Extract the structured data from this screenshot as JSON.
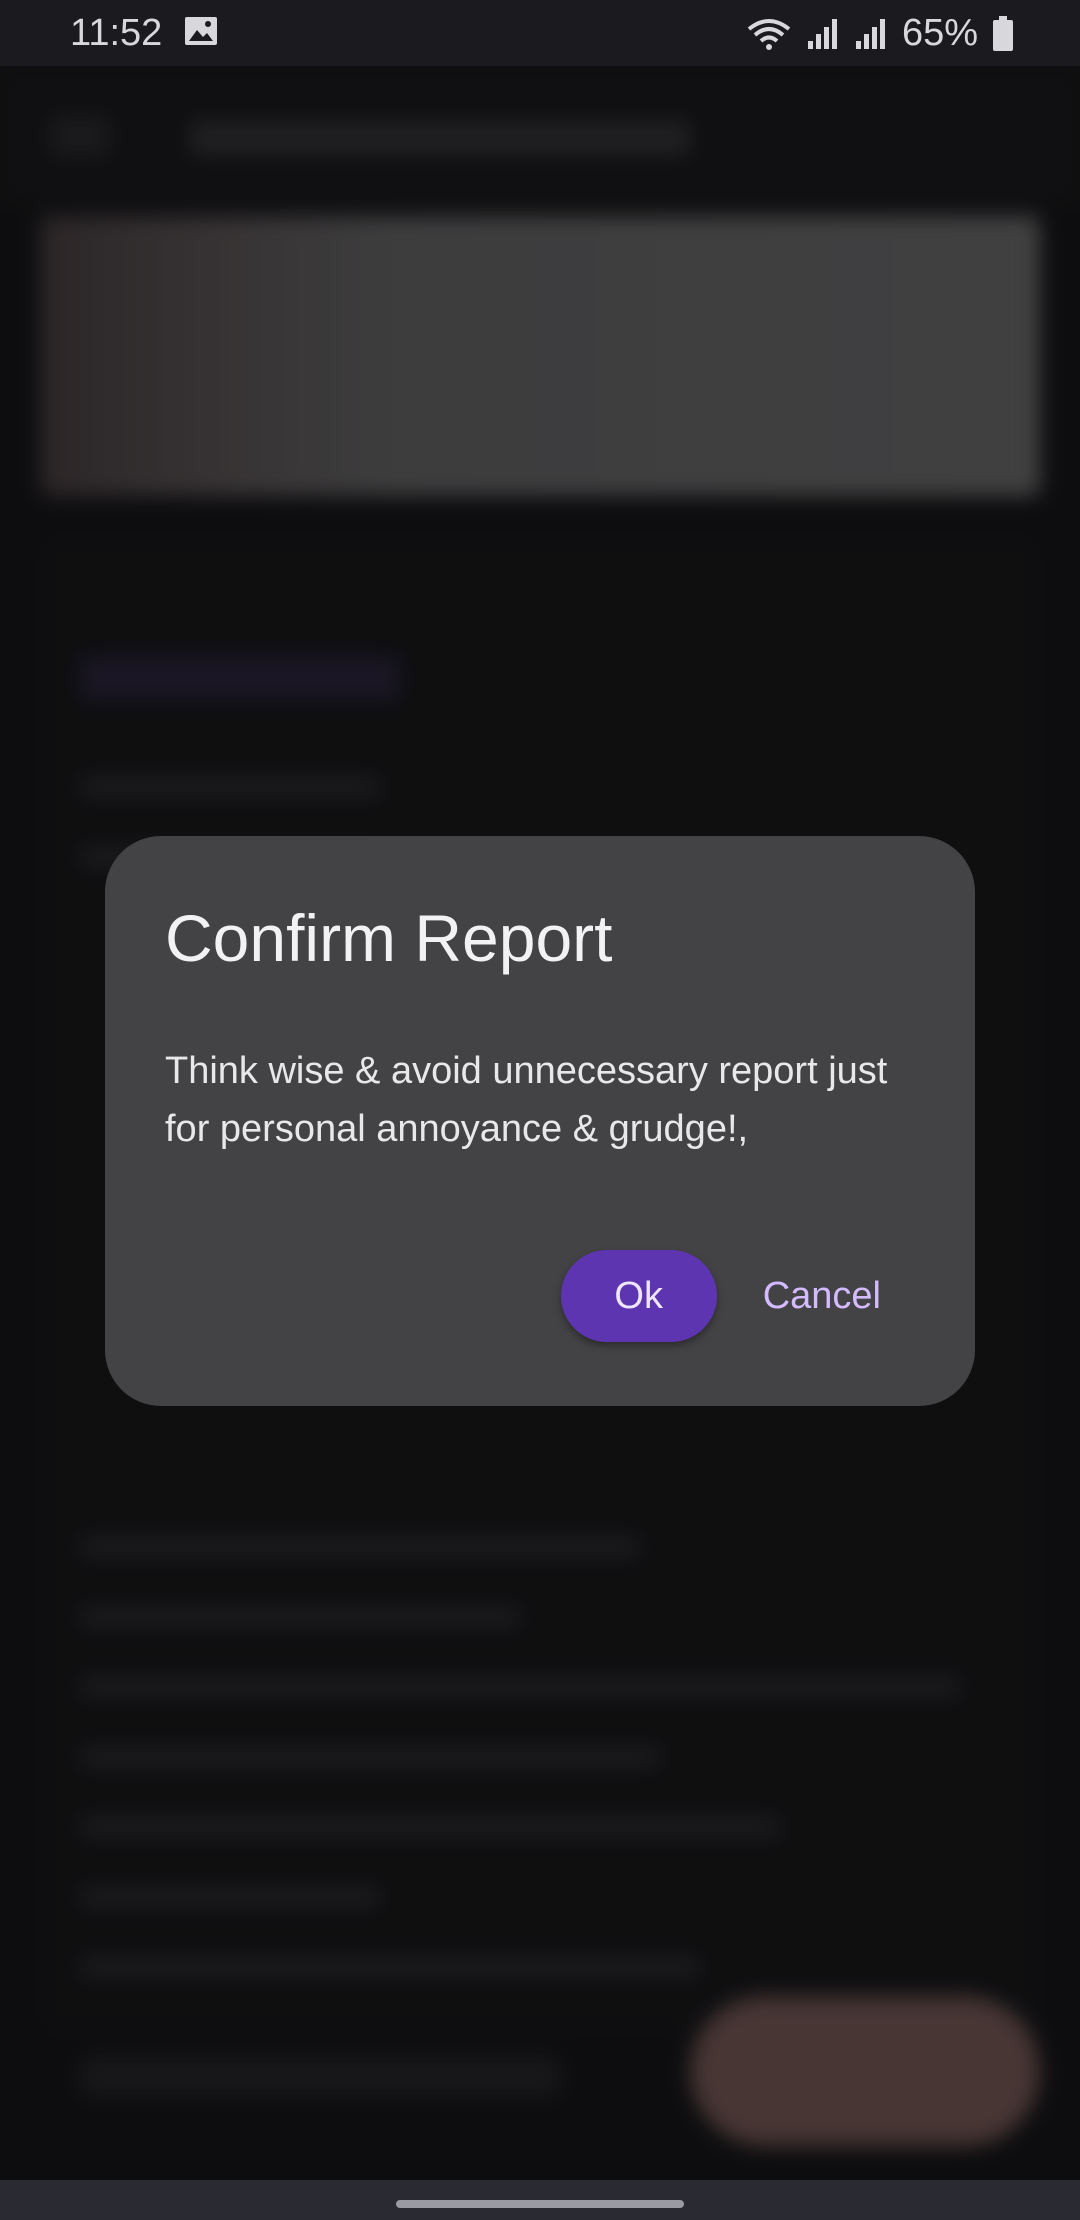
{
  "status_bar": {
    "time": "11:52",
    "battery_percent": "65%",
    "icons": [
      "image-icon",
      "wifi-icon",
      "signal-icon",
      "signal-icon-2",
      "battery-icon"
    ]
  },
  "dialog": {
    "title": "Confirm Report",
    "message": "Think wise & avoid unnecessary report just for personal annoyance & grudge!,",
    "ok_label": "Ok",
    "cancel_label": "Cancel"
  },
  "colors": {
    "dialog_bg": "#434345",
    "ok_button_bg": "#5e35b1",
    "cancel_text": "#d4bbff",
    "background": "#151518"
  }
}
